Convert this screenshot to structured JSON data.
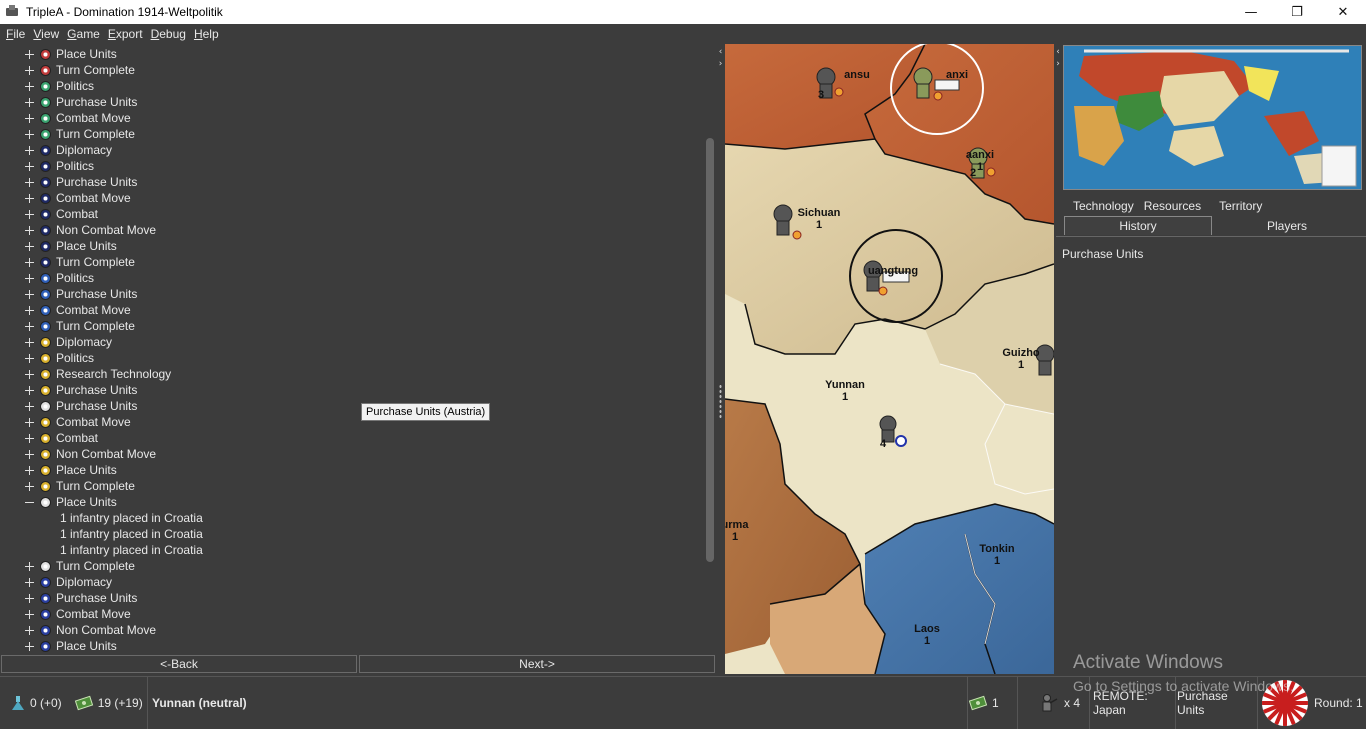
{
  "window": {
    "title": "TripleA - Domination 1914-Weltpolitik",
    "minimize_glyph": "—",
    "maximize_glyph": "❐",
    "close_glyph": "✕"
  },
  "menu": [
    "File",
    "View",
    "Game",
    "Export",
    "Debug",
    "Help"
  ],
  "history_tree": [
    {
      "label": "Place Units",
      "expander": "plus",
      "flag": "#c23b3b"
    },
    {
      "label": "Turn Complete",
      "expander": "plus",
      "flag": "#c23b3b"
    },
    {
      "label": "Politics",
      "expander": "plus",
      "flag": "#3aa370"
    },
    {
      "label": "Purchase Units",
      "expander": "plus",
      "flag": "#3aa370"
    },
    {
      "label": "Combat Move",
      "expander": "plus",
      "flag": "#3aa370"
    },
    {
      "label": "Turn Complete",
      "expander": "plus",
      "flag": "#3aa370"
    },
    {
      "label": "Diplomacy",
      "expander": "plus",
      "flag": "#1f2a66"
    },
    {
      "label": "Politics",
      "expander": "plus",
      "flag": "#1f2a66"
    },
    {
      "label": "Purchase Units",
      "expander": "plus",
      "flag": "#1f2a66"
    },
    {
      "label": "Combat Move",
      "expander": "plus",
      "flag": "#1f2a66"
    },
    {
      "label": "Combat",
      "expander": "plus",
      "flag": "#1f2a66"
    },
    {
      "label": "Non Combat Move",
      "expander": "plus",
      "flag": "#1f2a66"
    },
    {
      "label": "Place Units",
      "expander": "plus",
      "flag": "#1f2a66"
    },
    {
      "label": "Turn Complete",
      "expander": "plus",
      "flag": "#1f2a66"
    },
    {
      "label": "Politics",
      "expander": "plus",
      "flag": "#2f5fb8"
    },
    {
      "label": "Purchase Units",
      "expander": "plus",
      "flag": "#2f5fb8"
    },
    {
      "label": "Combat Move",
      "expander": "plus",
      "flag": "#2f5fb8"
    },
    {
      "label": "Turn Complete",
      "expander": "plus",
      "flag": "#2f5fb8"
    },
    {
      "label": "Diplomacy",
      "expander": "plus",
      "flag": "#d8b02c"
    },
    {
      "label": "Politics",
      "expander": "plus",
      "flag": "#d8b02c"
    },
    {
      "label": "Research Technology",
      "expander": "plus",
      "flag": "#d8b02c"
    },
    {
      "label": "Purchase Units",
      "expander": "plus",
      "flag": "#d8b02c"
    },
    {
      "label": "Purchase Units",
      "expander": "plus",
      "flag": "#e0e0e0"
    },
    {
      "label": "Combat Move",
      "expander": "plus",
      "flag": "#d8b02c"
    },
    {
      "label": "Combat",
      "expander": "plus",
      "flag": "#d8b02c"
    },
    {
      "label": "Non Combat Move",
      "expander": "plus",
      "flag": "#d8b02c"
    },
    {
      "label": "Place Units",
      "expander": "plus",
      "flag": "#d8b02c"
    },
    {
      "label": "Turn Complete",
      "expander": "plus",
      "flag": "#d8b02c"
    },
    {
      "label": "Place Units",
      "expander": "minus",
      "flag": "#e0e0e0"
    },
    {
      "label": "1 infantry placed in Croatia",
      "child": true
    },
    {
      "label": "1 infantry placed in Croatia",
      "child": true
    },
    {
      "label": "1 infantry placed in Croatia",
      "child": true
    },
    {
      "label": "Turn Complete",
      "expander": "plus",
      "flag": "#e0e0e0"
    },
    {
      "label": "Diplomacy",
      "expander": "plus",
      "flag": "#2a3fa0"
    },
    {
      "label": "Purchase Units",
      "expander": "plus",
      "flag": "#2a3fa0"
    },
    {
      "label": "Combat Move",
      "expander": "plus",
      "flag": "#2a3fa0"
    },
    {
      "label": "Non Combat Move",
      "expander": "plus",
      "flag": "#2a3fa0"
    },
    {
      "label": "Place Units",
      "expander": "plus",
      "flag": "#2a3fa0"
    }
  ],
  "tooltip": "Purchase Units (Austria)",
  "nav": {
    "back": "<-Back",
    "next": "Next->"
  },
  "map": {
    "territories": [
      {
        "name": "ansu",
        "value": "",
        "units": "3"
      },
      {
        "name": "anxi",
        "value": "",
        "units": ""
      },
      {
        "name": "aanxi",
        "value": "1",
        "units": "2"
      },
      {
        "name": "Sichuan",
        "value": "1",
        "units": ""
      },
      {
        "name": "uangtung",
        "value": "",
        "units": ""
      },
      {
        "name": "Guizho",
        "value": "1",
        "units": ""
      },
      {
        "name": "Yunnan",
        "value": "1",
        "units": "4"
      },
      {
        "name": "urma",
        "value": "1",
        "units": ""
      },
      {
        "name": "Tonkin",
        "value": "1",
        "units": ""
      },
      {
        "name": "Laos",
        "value": "1",
        "units": ""
      }
    ]
  },
  "right_panel": {
    "tabs_top": [
      "Technology",
      "Resources",
      "Territory"
    ],
    "tabs_bottom": [
      "History",
      "Players"
    ],
    "active_tab": "History",
    "history_text": "Purchase Units"
  },
  "status": {
    "tech": "0 (+0)",
    "pus": "19 (+19)",
    "territory": "Yunnan (neutral)",
    "cost": "1",
    "unit_count": "x 4",
    "remote": "REMOTE: Japan",
    "phase": "Purchase Units",
    "round": "Round: 1"
  },
  "watermark": {
    "line1": "Activate Windows",
    "line2": "Go to Settings to activate Windows."
  },
  "colors": {
    "panel_bg": "#3c3c3c",
    "text": "#e8e8e8",
    "neutral_land": "#e8dfc0",
    "japan_red": "#c81e1e"
  }
}
